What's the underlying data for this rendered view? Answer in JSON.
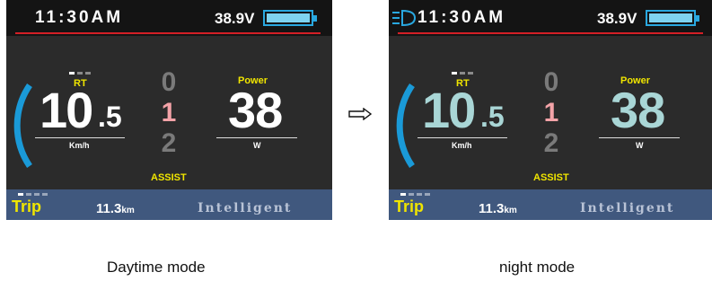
{
  "panels": [
    {
      "clock": "11:30AM",
      "voltage": "38.9V",
      "battery_level": 1.0,
      "headlight_on": false,
      "rt_label": "RT",
      "speed_int": "10",
      "speed_dec": ".5",
      "speed_unit": "Km/h",
      "assist_levels": [
        "0",
        "1",
        "2"
      ],
      "assist_selected": 1,
      "power_label": "Power",
      "power_value": "38",
      "power_unit": "W",
      "assist_label": "ASSIST",
      "trip_label": "Trip",
      "trip_value": "11.3",
      "trip_unit": "km",
      "mode_text": "Intelligent",
      "value_color": "#ffffff",
      "caption": "Daytime mode"
    },
    {
      "clock": "11:30AM",
      "voltage": "38.9V",
      "battery_level": 1.0,
      "headlight_on": true,
      "rt_label": "RT",
      "speed_int": "10",
      "speed_dec": ".5",
      "speed_unit": "Km/h",
      "assist_levels": [
        "0",
        "1",
        "2"
      ],
      "assist_selected": 1,
      "power_label": "Power",
      "power_value": "38",
      "power_unit": "W",
      "assist_label": "ASSIST",
      "trip_label": "Trip",
      "trip_value": "11.3",
      "trip_unit": "km",
      "mode_text": "Intelligent",
      "value_color": "#a9d6d6",
      "caption": "night mode"
    }
  ],
  "colors": {
    "accent_blue": "#1a9ad8",
    "label_yellow": "#f0e500",
    "assist_selected": "#f4a3a8",
    "assist_unselected": "#7a7a7a",
    "red_rule": "#d41f26"
  },
  "arrow_icon": "right-arrow-icon"
}
